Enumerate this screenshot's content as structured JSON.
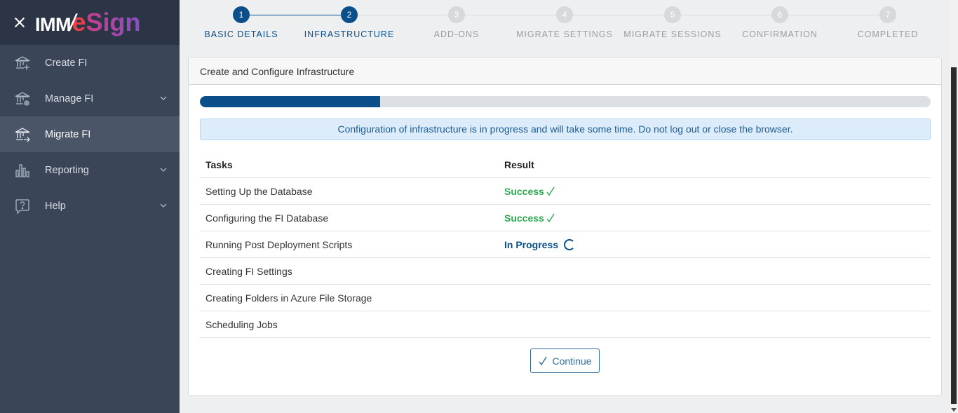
{
  "app": {
    "logo_imm": "IMM",
    "logo_slash": "/",
    "logo_e": "e",
    "logo_sign": "Sign"
  },
  "sidebar": {
    "items": [
      {
        "label": "Create FI",
        "icon": "bank-plus-icon",
        "has_chevron": false
      },
      {
        "label": "Manage FI",
        "icon": "bank-gear-icon",
        "has_chevron": true
      },
      {
        "label": "Migrate FI",
        "icon": "bank-arrow-icon",
        "has_chevron": false,
        "active": true
      },
      {
        "label": "Reporting",
        "icon": "bar-chart-icon",
        "has_chevron": true
      },
      {
        "label": "Help",
        "icon": "help-icon",
        "has_chevron": true
      }
    ]
  },
  "stepper": {
    "steps": [
      {
        "number": "1",
        "label": "BASIC DETAILS",
        "state": "active"
      },
      {
        "number": "2",
        "label": "INFRASTRUCTURE",
        "state": "active"
      },
      {
        "number": "3",
        "label": "ADD-ONS",
        "state": "pending"
      },
      {
        "number": "4",
        "label": "MIGRATE SETTINGS",
        "state": "pending"
      },
      {
        "number": "5",
        "label": "MIGRATE SESSIONS",
        "state": "pending"
      },
      {
        "number": "6",
        "label": "CONFIRMATION",
        "state": "pending"
      },
      {
        "number": "7",
        "label": "COMPLETED",
        "state": "pending"
      }
    ]
  },
  "card": {
    "title": "Create and Configure Infrastructure",
    "progress_percent": 24.7,
    "alert": "Configuration of infrastructure is in progress and will take some time. Do not log out or close the browser.",
    "table": {
      "headers": {
        "task": "Tasks",
        "result": "Result"
      },
      "rows": [
        {
          "task": "Setting Up the Database",
          "result": "Success",
          "status": "success"
        },
        {
          "task": "Configuring the FI Database",
          "result": "Success",
          "status": "success"
        },
        {
          "task": "Running Post Deployment Scripts",
          "result": "In Progress",
          "status": "progress"
        },
        {
          "task": "Creating FI Settings",
          "result": "",
          "status": "none"
        },
        {
          "task": "Creating Folders in Azure File Storage",
          "result": "",
          "status": "none"
        },
        {
          "task": "Scheduling Jobs",
          "result": "",
          "status": "none"
        }
      ]
    },
    "continue_label": "Continue"
  },
  "colors": {
    "primary": "#0a4e8a",
    "success": "#2ca94f",
    "sidebar_bg": "#3a4558",
    "sidebar_header_bg": "#2c3546"
  }
}
